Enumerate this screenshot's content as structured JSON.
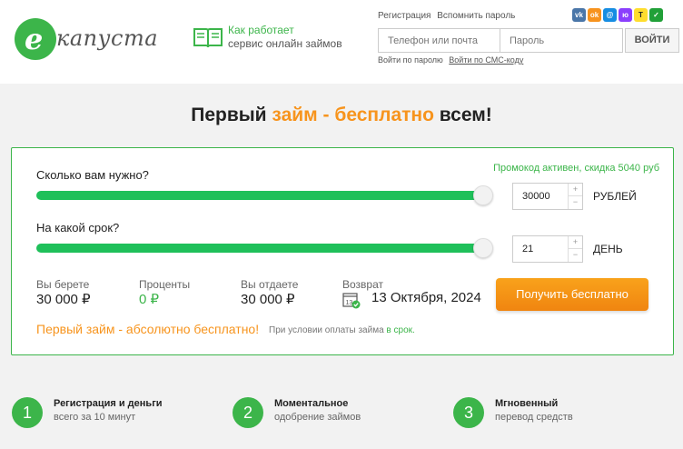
{
  "header": {
    "logo_letter": "е",
    "logo_text": "капуста",
    "how_line1": "Как работает",
    "how_line2": "сервис онлайн займов",
    "register_link": "Регистрация",
    "remind_link": "Вспомнить пароль",
    "socials": [
      {
        "name": "vk-icon",
        "glyph": "vk",
        "color": "#4a76a8"
      },
      {
        "name": "odnoklassniki-icon",
        "glyph": "ok",
        "color": "#f7931e"
      },
      {
        "name": "mail-icon",
        "glyph": "@",
        "color": "#168de2"
      },
      {
        "name": "yoomoney-icon",
        "glyph": "ю",
        "color": "#8b3ffd"
      },
      {
        "name": "tinkoff-icon",
        "glyph": "T",
        "color": "#ffdd2d"
      },
      {
        "name": "sber-icon",
        "glyph": "✓",
        "color": "#21a038"
      }
    ],
    "phone_placeholder": "Телефон или почта",
    "password_placeholder": "Пароль",
    "login_button": "ВОЙТИ",
    "login_by_password": "Войти по паролю",
    "login_by_sms": "Войти по СМС-коду"
  },
  "headline": {
    "part1": "Первый ",
    "highlight": "займ - бесплатно",
    "part2": " всем!"
  },
  "calculator": {
    "amount_label": "Сколько вам нужно?",
    "promo": "Промокод активен, скидка 5040 руб",
    "amount_value": "30000",
    "amount_unit": "РУБЛЕЙ",
    "amount_fill": 1.0,
    "term_label": "На какой срок?",
    "term_value": "21",
    "term_unit": "ДЕНЬ",
    "term_fill": 1.0,
    "stats": {
      "take_label": "Вы берете",
      "take_value": "30 000 ₽",
      "interest_label": "Проценты",
      "interest_value": "0 ₽",
      "give_label": "Вы отдаете",
      "give_value": "30 000 ₽",
      "return_label": "Возврат",
      "return_date": "13 Октября, 2024",
      "calendar_day": "13"
    },
    "cta_button": "Получить бесплатно",
    "free_note": "Первый займ - абсолютно бесплатно!",
    "condition_prefix": "При условии оплаты займа ",
    "condition_highlight": "в срок."
  },
  "steps": [
    {
      "num": "1",
      "title": "Регистрация и деньги",
      "sub": "всего за 10 минут"
    },
    {
      "num": "2",
      "title": "Моментальное",
      "sub": "одобрение займов"
    },
    {
      "num": "3",
      "title": "Мгновенный",
      "sub": "перевод средств"
    }
  ],
  "colors": {
    "brand_green": "#3cb54a",
    "slider_green": "#1fc05a",
    "accent_orange": "#f7941d"
  }
}
